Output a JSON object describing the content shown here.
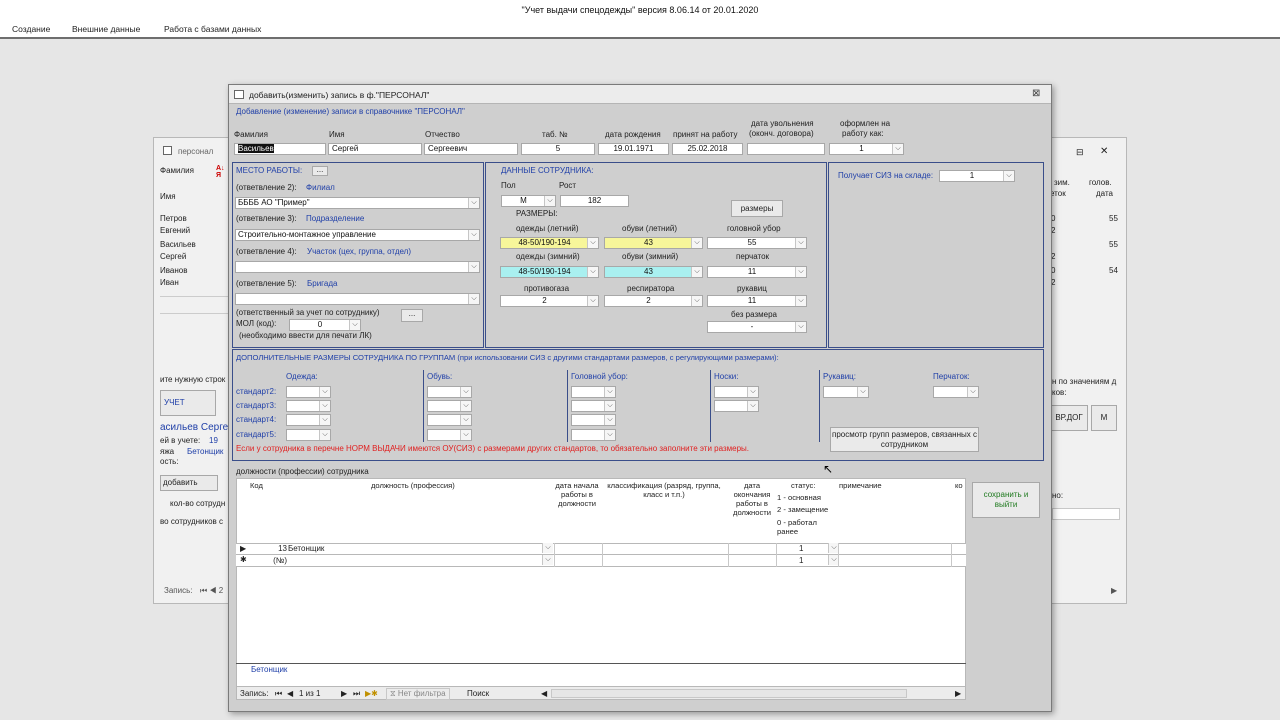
{
  "app": {
    "title": "\"Учет выдачи спецодежды\" версия 8.06.14 от 20.01.2020"
  },
  "ribbon": {
    "tabs": [
      "Создание",
      "Внешние данные",
      "Работа с базами данных"
    ]
  },
  "bg_form": {
    "title": "персонал",
    "labels": {
      "surname": "Фамилия",
      "name": "Имя",
      "find": "ите нужную строк",
      "uchet": "УЧЕТ",
      "current": "асильев Серге",
      "in_uchet": "ей в учете:",
      "in_uchet_val": "19",
      "dolzh": "яжа",
      "beton": "Бетонщик",
      "nost": "ость:",
      "add": "добавить",
      "kolvo": "кол-во сотрудн",
      "kolvo2": "во сотрудников с",
      "zapis": "Запись:",
      "r1": "зим.",
      "r1b": "еток",
      "r2": "голов.",
      "r2b": "дата",
      "by_values": "н по значениям д",
      "kov": "ков:",
      "vrdog": "ВР.ДОГ",
      "m": "М",
      "no": "но:"
    },
    "rows": [
      "Петров",
      "Евгений",
      "Васильев",
      "Сергей",
      "Иванов",
      "Иван"
    ],
    "right_vals": [
      "55",
      "55",
      "54"
    ],
    "right_small": [
      "0",
      "2",
      "2",
      "0",
      "2"
    ]
  },
  "dialog": {
    "title": "добавить(изменить) запись в ф.\"ПЕРСОНАЛ\"",
    "subtitle": "Добавление (изменение) записи в справочнике \"ПЕРСОНАЛ\"",
    "header": {
      "labels": [
        "Фамилия",
        "Имя",
        "Отчество",
        "таб. №",
        "дата рождения",
        "принят на работу",
        "дата увольнения",
        "(оконч. договора)",
        "оформлен на",
        "работу как:"
      ],
      "surname": "Васильев",
      "name": "Сергей",
      "patronymic": "Сергеевич",
      "tab_no": "5",
      "birth_date": "19.01.1971",
      "hire_date": "25.02.2018",
      "dismiss_date": "",
      "employment": "1"
    },
    "workplace": {
      "title": "МЕСТО РАБОТЫ:",
      "dots": "...",
      "branch_prefix": "(ответвление 2):",
      "branch_label": "Филиал",
      "branch_value": "ББББ АО \"Пример\"",
      "division_prefix": "(ответвление 3):",
      "division_label": "Подразделение",
      "division_value": "Строительно-монтажное управление",
      "site_prefix": "(ответвление 4):",
      "site_label": "Участок (цех, группа, отдел)",
      "site_value": "",
      "brigade_prefix": "(ответвление 5):",
      "brigade_label": "Бригада",
      "brigade_value": "",
      "responsible": "(ответственный за учет по сотруднику)",
      "mol_label": "МОЛ (код):",
      "mol_value": "0",
      "mol_note": "(необходимо ввести для печати ЛК)"
    },
    "employee": {
      "title": "ДАННЫЕ СОТРУДНИКА:",
      "sex_label": "Пол",
      "sex_value": "М",
      "height_label": "Рост",
      "height_value": "182",
      "sizes_label": "РАЗМЕРЫ:",
      "sizes_button": "размеры",
      "clothes_summer_label": "одежды (летний)",
      "clothes_summer": "48-50/190-194",
      "shoes_summer_label": "обуви (летний)",
      "shoes_summer": "43",
      "headwear_label": "головной убор",
      "headwear": "55",
      "clothes_winter_label": "одежды (зимний)",
      "clothes_winter": "48-50/190-194",
      "shoes_winter_label": "обуви (зимний)",
      "shoes_winter": "43",
      "gloves_label": "перчаток",
      "gloves": "11",
      "gasmask_label": "противогаза",
      "gasmask": "2",
      "respirator_label": "респиратора",
      "respirator": "2",
      "mittens_label": "рукавиц",
      "mittens": "11",
      "nosize_label": "без размера",
      "nosize": "-"
    },
    "warehouse": {
      "label": "Получает СИЗ на складе:",
      "value": "1"
    },
    "groups": {
      "title": "ДОПОЛНИТЕЛЬНЫЕ РАЗМЕРЫ СОТРУДНИКА ПО ГРУППАМ (при использовании СИЗ с другими стандартами размеров, с регулирующими размерами):",
      "clothes": "Одежда:",
      "shoes": "Обувь:",
      "head": "Головной убор:",
      "socks": "Носки:",
      "mittens": "Рукавиц:",
      "gloves": "Перчаток:",
      "standards": [
        "стандарт2:",
        "стандарт3:",
        "стандарт4:",
        "стандарт5:"
      ],
      "warning": "Если у сотрудника в перечне НОРМ ВЫДАЧИ имеются ОУ(СИЗ) с размерами других стандартов, то обязательно заполните эти размеры.",
      "view_button": "просмотр групп размеров, связанных с сотрудником"
    },
    "positions": {
      "title": "должности (профессии) сотрудника",
      "columns": {
        "code": "Код",
        "position": "должность (профессия)",
        "start": "дата начала работы в должности",
        "class": "классификация (разряд, группа, класс и т.п.)",
        "end": "дата окончания работы в должности",
        "status": "статус:",
        "note": "примечание",
        "ko": "ко"
      },
      "status_legend": [
        "1 - основная",
        "2 - замещение",
        "0 - работал ранее"
      ],
      "rows": [
        {
          "code": "13",
          "position": "Бетонщик",
          "status": "1"
        },
        {
          "code": "(№)",
          "position": "",
          "status": "1"
        }
      ],
      "footer_value": "Бетонщик"
    },
    "save_button": "сохранить и выйти",
    "nav": {
      "record_label": "Запись:",
      "record_pos": "1 из 1",
      "no_filter": "Нет фильтра",
      "search": "Поиск"
    }
  }
}
